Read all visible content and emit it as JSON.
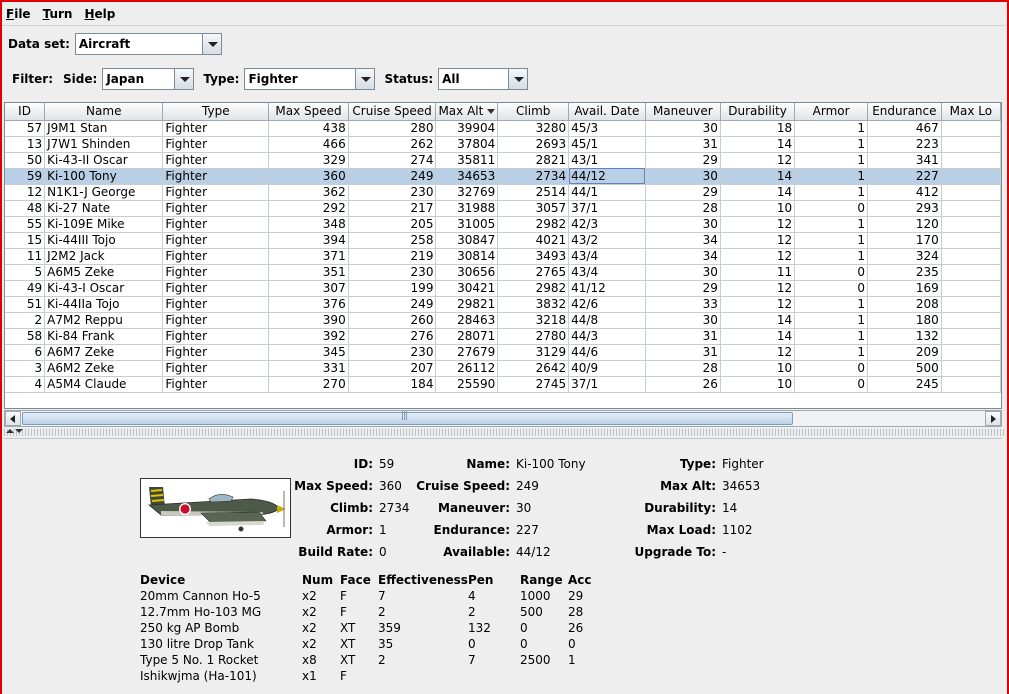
{
  "menu": [
    {
      "label": "File",
      "key": "F",
      "rest": "ile"
    },
    {
      "label": "Turn",
      "key": "T",
      "rest": "urn"
    },
    {
      "label": "Help",
      "key": "H",
      "rest": "elp"
    }
  ],
  "dataset": {
    "label": "Data set:",
    "value": "Aircraft"
  },
  "filter": {
    "label": "Filter:",
    "side_label": "Side:",
    "side_value": "Japan",
    "type_label": "Type:",
    "type_value": "Fighter",
    "status_label": "Status:",
    "status_value": "All"
  },
  "table": {
    "columns": [
      "ID",
      "Name",
      "Type",
      "Max Speed",
      "Cruise Speed",
      "Max Alt",
      "Climb",
      "Avail. Date",
      "Maneuver",
      "Durability",
      "Armor",
      "Endurance",
      "Max Lo"
    ],
    "sorted_column": "Max Alt",
    "rows": [
      [
        "57",
        "J9M1 Stan",
        "Fighter",
        "438",
        "280",
        "39904",
        "3280",
        "45/3",
        "30",
        "18",
        "1",
        "467"
      ],
      [
        "13",
        "J7W1 Shinden",
        "Fighter",
        "466",
        "262",
        "37804",
        "2693",
        "45/1",
        "31",
        "14",
        "1",
        "223"
      ],
      [
        "50",
        "Ki-43-II Oscar",
        "Fighter",
        "329",
        "274",
        "35811",
        "2821",
        "43/1",
        "29",
        "12",
        "1",
        "341"
      ],
      [
        "59",
        "Ki-100 Tony",
        "Fighter",
        "360",
        "249",
        "34653",
        "2734",
        "44/12",
        "30",
        "14",
        "1",
        "227"
      ],
      [
        "12",
        "N1K1-J George",
        "Fighter",
        "362",
        "230",
        "32769",
        "2514",
        "44/1",
        "29",
        "14",
        "1",
        "412"
      ],
      [
        "48",
        "Ki-27 Nate",
        "Fighter",
        "292",
        "217",
        "31988",
        "3057",
        "37/1",
        "28",
        "10",
        "0",
        "293"
      ],
      [
        "55",
        "Ki-109E Mike",
        "Fighter",
        "348",
        "205",
        "31005",
        "2982",
        "42/3",
        "30",
        "12",
        "1",
        "120"
      ],
      [
        "15",
        "Ki-44III Tojo",
        "Fighter",
        "394",
        "258",
        "30847",
        "4021",
        "43/2",
        "34",
        "12",
        "1",
        "170"
      ],
      [
        "11",
        "J2M2 Jack",
        "Fighter",
        "371",
        "219",
        "30814",
        "3493",
        "43/4",
        "34",
        "12",
        "1",
        "324"
      ],
      [
        "5",
        "A6M5 Zeke",
        "Fighter",
        "351",
        "230",
        "30656",
        "2765",
        "43/4",
        "30",
        "11",
        "0",
        "235"
      ],
      [
        "49",
        "Ki-43-I Oscar",
        "Fighter",
        "307",
        "199",
        "30421",
        "2982",
        "41/12",
        "29",
        "12",
        "0",
        "169"
      ],
      [
        "51",
        "Ki-44IIa Tojo",
        "Fighter",
        "376",
        "249",
        "29821",
        "3832",
        "42/6",
        "33",
        "12",
        "1",
        "208"
      ],
      [
        "2",
        "A7M2 Reppu",
        "Fighter",
        "390",
        "260",
        "28463",
        "3218",
        "44/8",
        "30",
        "14",
        "1",
        "180"
      ],
      [
        "58",
        "Ki-84 Frank",
        "Fighter",
        "392",
        "276",
        "28071",
        "2780",
        "44/3",
        "31",
        "14",
        "1",
        "132"
      ],
      [
        "6",
        "A6M7 Zeke",
        "Fighter",
        "345",
        "230",
        "27679",
        "3129",
        "44/6",
        "31",
        "12",
        "1",
        "209"
      ],
      [
        "3",
        "A6M2 Zeke",
        "Fighter",
        "331",
        "207",
        "26112",
        "2642",
        "40/9",
        "28",
        "10",
        "0",
        "500"
      ],
      [
        "4",
        "A5M4 Claude",
        "Fighter",
        "270",
        "184",
        "25590",
        "2745",
        "37/1",
        "26",
        "10",
        "0",
        "245"
      ]
    ],
    "selected_id": "59"
  },
  "detail": {
    "id_label": "ID:",
    "id": "59",
    "name_label": "Name:",
    "name": "Ki-100 Tony",
    "type_label": "Type:",
    "type": "Fighter",
    "maxspeed_label": "Max Speed:",
    "maxspeed": "360",
    "cruise_label": "Cruise Speed:",
    "cruise": "249",
    "maxalt_label": "Max Alt:",
    "maxalt": "34653",
    "climb_label": "Climb:",
    "climb": "2734",
    "maneuver_label": "Maneuver:",
    "maneuver": "30",
    "durability_label": "Durability:",
    "durability": "14",
    "armor_label": "Armor:",
    "armor": "1",
    "endurance_label": "Endurance:",
    "endurance": "227",
    "maxload_label": "Max Load:",
    "maxload": "1102",
    "buildrate_label": "Build Rate:",
    "buildrate": "0",
    "available_label": "Available:",
    "available": "44/12",
    "upgrade_label": "Upgrade To:",
    "upgrade": "-"
  },
  "devices": {
    "headers": [
      "Device",
      "Num",
      "Face",
      "Effectiveness",
      "Pen",
      "Range",
      "Acc"
    ],
    "rows": [
      [
        "20mm Cannon Ho-5",
        "x2",
        "F",
        "7",
        "4",
        "1000",
        "29"
      ],
      [
        "12.7mm Ho-103 MG",
        "x2",
        "F",
        "2",
        "2",
        "500",
        "28"
      ],
      [
        "250 kg AP Bomb",
        "x2",
        "XT",
        "359",
        "132",
        "0",
        "26"
      ],
      [
        "130 litre Drop Tank",
        "x2",
        "XT",
        "35",
        "0",
        "0",
        "0"
      ],
      [
        "Type 5 No. 1 Rocket",
        "x8",
        "XT",
        "2",
        "7",
        "2500",
        "1"
      ],
      [
        "Ishikwjma (Ha-101)",
        "x1",
        "F",
        "",
        "",
        "",
        ""
      ]
    ]
  },
  "colors": {
    "selection": "#b8cfe5",
    "window_border": "#e00000"
  }
}
